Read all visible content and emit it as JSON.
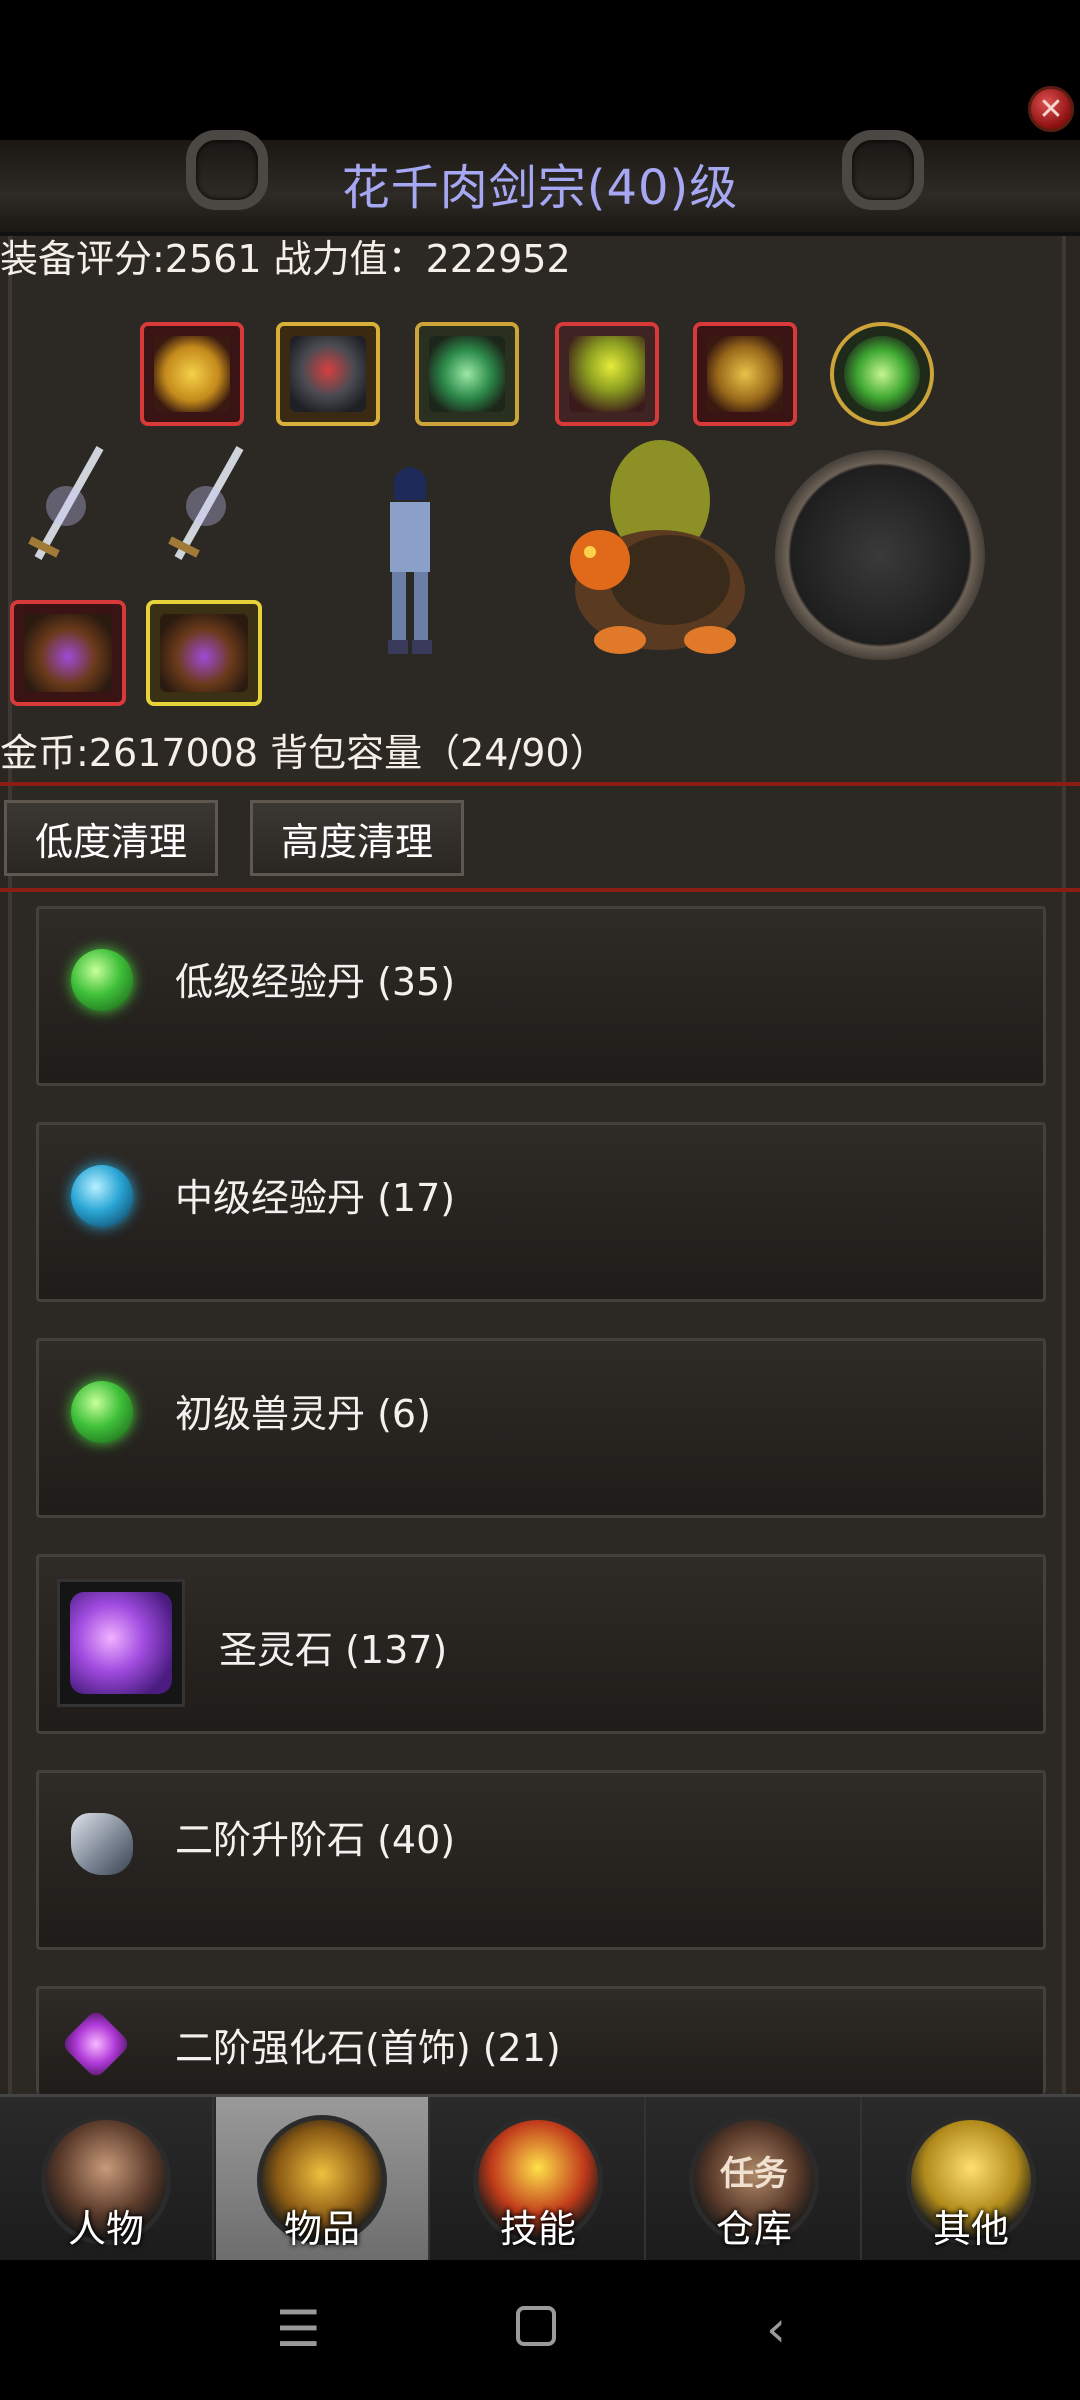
{
  "header": {
    "title": "花千肉剑宗(40)级",
    "close_icon": "close-icon"
  },
  "stats": {
    "equip_score_label": "装备评分:2561 战力值：222952",
    "gold_label": "金币:2617008 背包容量（24/90）"
  },
  "buttons": {
    "low_clean": "低度清理",
    "high_clean": "高度清理"
  },
  "items": [
    {
      "label": "低级经验丹 (35)",
      "icon": "green-orb-icon"
    },
    {
      "label": "中级经验丹 (17)",
      "icon": "blue-orb-icon"
    },
    {
      "label": "初级兽灵丹 (6)",
      "icon": "green-orb-icon"
    },
    {
      "label": "圣灵石 (137)",
      "icon": "purple-gem-icon"
    },
    {
      "label": "二阶升阶石 (40)",
      "icon": "grey-stone-icon"
    },
    {
      "label": "二阶强化石(首饰) (21)",
      "icon": "purple-crystal-icon"
    }
  ],
  "tabs": [
    {
      "label": "人物",
      "icon": "character-portrait-icon",
      "active": false
    },
    {
      "label": "物品",
      "icon": "helmet-icon",
      "active": true
    },
    {
      "label": "技能",
      "icon": "sword-icon",
      "active": false
    },
    {
      "label": "仓库",
      "icon": "chest-icon",
      "active": false
    },
    {
      "label": "其他",
      "icon": "trophy-icon",
      "active": false
    }
  ],
  "tab_overlay_text": "任务",
  "colors": {
    "title": "#a7a8f3",
    "divider": "#8b1d13",
    "panel_bg": "#2c2823"
  }
}
